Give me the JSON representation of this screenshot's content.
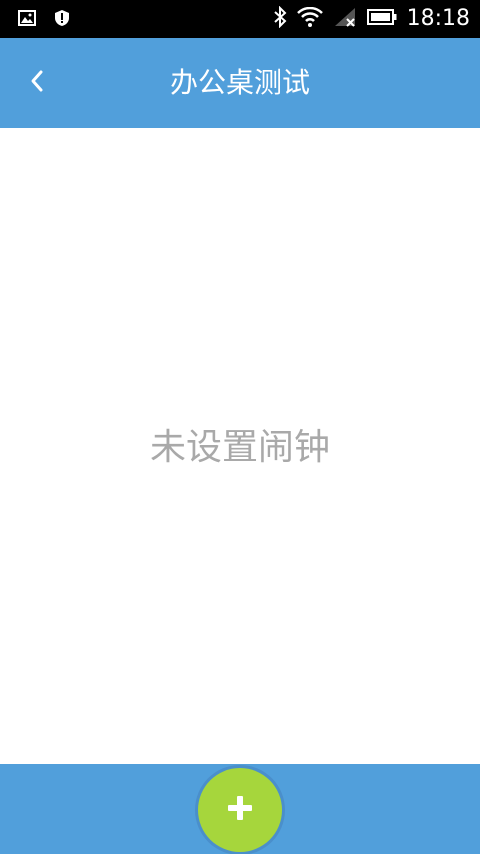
{
  "status_bar": {
    "time": "18:18",
    "icons": [
      "image-icon",
      "shield-icon",
      "bluetooth-icon",
      "wifi-icon",
      "signal-off-icon",
      "battery-icon"
    ]
  },
  "app_bar": {
    "title": "办公桌测试",
    "back_icon": "chevron-left-icon"
  },
  "content": {
    "empty_message": "未设置闹钟"
  },
  "bottom_bar": {
    "add_icon": "plus-icon"
  },
  "colors": {
    "primary": "#519fdb",
    "fab": "#a6d63c",
    "empty_text": "#a9a9a9",
    "status_bar": "#000000"
  }
}
